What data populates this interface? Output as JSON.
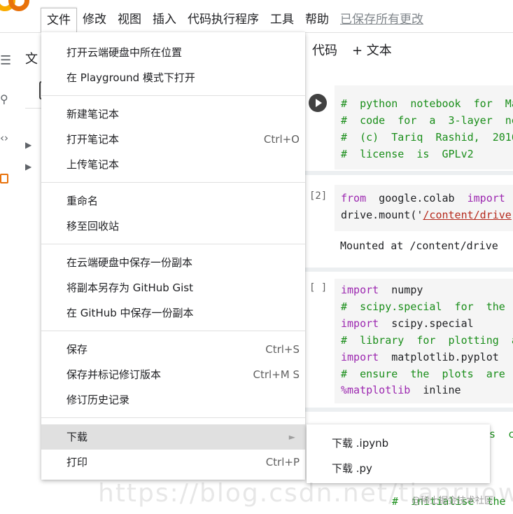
{
  "menubar": {
    "items": [
      "文件",
      "修改",
      "视图",
      "插入",
      "代码执行程序",
      "工具",
      "帮助"
    ],
    "saved_status": "已保存所有更改"
  },
  "sidebar": {
    "title": "文"
  },
  "toolbar": {
    "add_code": "代码",
    "add_text": "+ 文本"
  },
  "cells": {
    "cell1_lines": [
      "#  python  notebook  for  Ma",
      "#  code  for  a  3-layer  ne",
      "#  (c)  Tariq  Rashid,  2016",
      "#  license  is  GPLv2"
    ],
    "cell2_count": "[2]",
    "cell2_line1_kw1": "from",
    "cell2_line1_mid": "  google.colab  ",
    "cell2_line1_kw2": "import",
    "cell2_line2_pre": "drive.mount('",
    "cell2_line2_str": "/content/drive",
    "cell2_line2_post": "'",
    "cell2_output": "Mounted at /content/drive",
    "cell3_count": "[ ]",
    "cell3_lines": [
      {
        "kw": "import",
        "rest": "  numpy"
      },
      {
        "cmt": "#  scipy.special  for  the"
      },
      {
        "kw": "import",
        "rest": "  scipy.special"
      },
      {
        "cmt": "#  library  for  plotting  a"
      },
      {
        "kw": "import",
        "rest": "  matplotlib.pyplot"
      },
      {
        "cmt": "#  ensure  the  plots  are"
      },
      {
        "mag": "%matplotlib",
        "rest": "  inline"
      }
    ],
    "cell4_partial": "ss  c",
    "cell5_partial": "#  initialise  the"
  },
  "file_menu": {
    "items": [
      {
        "label": "打开云端硬盘中所在位置",
        "shortcut": ""
      },
      {
        "label": "在 Playground 模式下打开",
        "shortcut": ""
      },
      {
        "label": "新建笔记本",
        "shortcut": ""
      },
      {
        "label": "打开笔记本",
        "shortcut": "Ctrl+O"
      },
      {
        "label": "上传笔记本",
        "shortcut": ""
      },
      {
        "label": "重命名",
        "shortcut": ""
      },
      {
        "label": "移至回收站",
        "shortcut": ""
      },
      {
        "label": "在云端硬盘中保存一份副本",
        "shortcut": ""
      },
      {
        "label": "将副本另存为 GitHub Gist",
        "shortcut": ""
      },
      {
        "label": "在 GitHub 中保存一份副本",
        "shortcut": ""
      },
      {
        "label": "保存",
        "shortcut": "Ctrl+S"
      },
      {
        "label": "保存并标记修订版本",
        "shortcut": "Ctrl+M S"
      },
      {
        "label": "修订历史记录",
        "shortcut": ""
      },
      {
        "label": "下载",
        "shortcut": ""
      },
      {
        "label": "打印",
        "shortcut": "Ctrl+P"
      }
    ]
  },
  "download_submenu": {
    "items": [
      "下载 .ipynb",
      "下载 .py"
    ]
  },
  "watermark": {
    "url": "https://blog.csdn.net/tianruowudi",
    "brand": "@稀土掘金技术社区"
  }
}
